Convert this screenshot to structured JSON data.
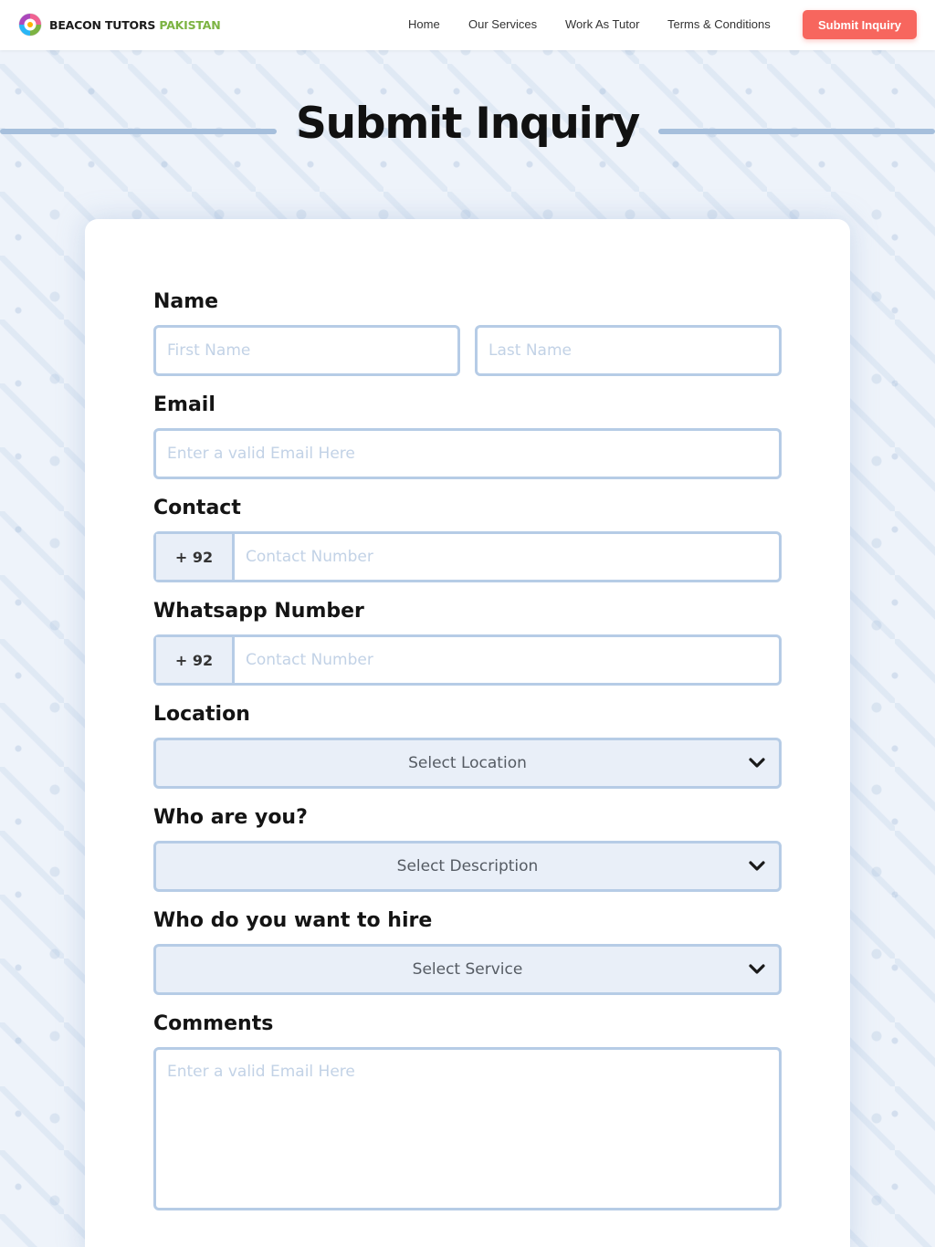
{
  "brand": {
    "name_main": "BEACON TUTORS",
    "name_accent": "PAKISTAN"
  },
  "nav": {
    "items": [
      {
        "label": "Home"
      },
      {
        "label": "Our Services"
      },
      {
        "label": "Work As Tutor"
      },
      {
        "label": "Terms & Conditions"
      }
    ],
    "cta_label": "Submit Inquiry"
  },
  "page": {
    "title": "Submit Inquiry"
  },
  "form": {
    "name": {
      "label": "Name",
      "first_placeholder": "First Name",
      "last_placeholder": "Last Name"
    },
    "email": {
      "label": "Email",
      "placeholder": "Enter a valid Email Here"
    },
    "contact": {
      "label": "Contact",
      "prefix": "+ 92",
      "placeholder": "Contact Number"
    },
    "whatsapp": {
      "label": "Whatsapp Number",
      "prefix": "+ 92",
      "placeholder": "Contact Number"
    },
    "location": {
      "label": "Location",
      "selected": "Select Location"
    },
    "who_are_you": {
      "label": "Who are you?",
      "selected": "Select Description"
    },
    "hire": {
      "label": "Who do you want to hire",
      "selected": "Select Service"
    },
    "comments": {
      "label": "Comments",
      "placeholder": "Enter a valid Email Here"
    }
  },
  "colors": {
    "accent": "#f7665e",
    "brand_green": "#7cb342",
    "field_border": "#b6cce6",
    "select_bg": "#e9eff8"
  },
  "icons": {
    "logo": "beacon-logo-icon",
    "dropdown": "chevron-down-icon"
  }
}
